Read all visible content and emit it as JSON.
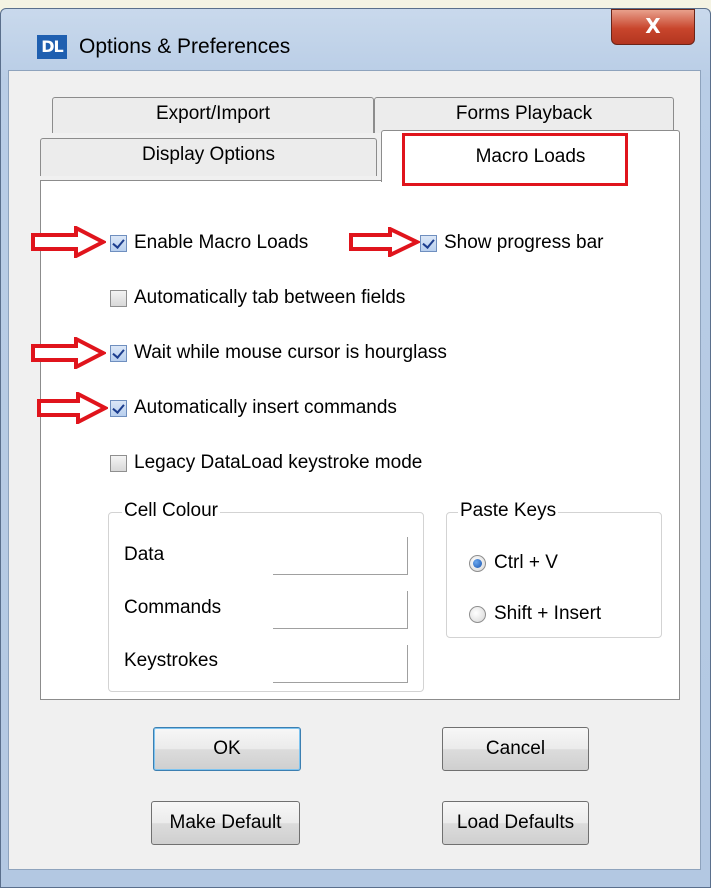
{
  "window": {
    "title": "Options & Preferences",
    "app_icon_text": "DL",
    "close_glyph": "X"
  },
  "tabs": [
    {
      "label": "Export/Import",
      "active": false
    },
    {
      "label": "Forms Playback",
      "active": false
    },
    {
      "label": "Display Options",
      "active": false
    },
    {
      "label": "Macro Loads",
      "active": true
    }
  ],
  "checkboxes": [
    {
      "label": "Enable Macro Loads",
      "checked": true
    },
    {
      "label": "Show progress bar",
      "checked": true
    },
    {
      "label": "Automatically tab between fields",
      "checked": false
    },
    {
      "label": "Wait while mouse cursor is hourglass",
      "checked": true
    },
    {
      "label": "Automatically insert commands",
      "checked": true
    },
    {
      "label": "Legacy DataLoad keystroke mode",
      "checked": false
    }
  ],
  "cell_colour": {
    "legend": "Cell Colour",
    "rows": [
      {
        "label": "Data"
      },
      {
        "label": "Commands"
      },
      {
        "label": "Keystrokes"
      }
    ]
  },
  "paste_keys": {
    "legend": "Paste Keys",
    "options": [
      {
        "label": "Ctrl + V",
        "selected": true
      },
      {
        "label": "Shift + Insert",
        "selected": false
      }
    ]
  },
  "buttons": {
    "ok": "OK",
    "cancel": "Cancel",
    "make_default": "Make Default",
    "load_defaults": "Load Defaults"
  },
  "colors": {
    "annotation": "#e0141c",
    "titlebar": "#b9cde6",
    "accent": "#1b56b0"
  }
}
